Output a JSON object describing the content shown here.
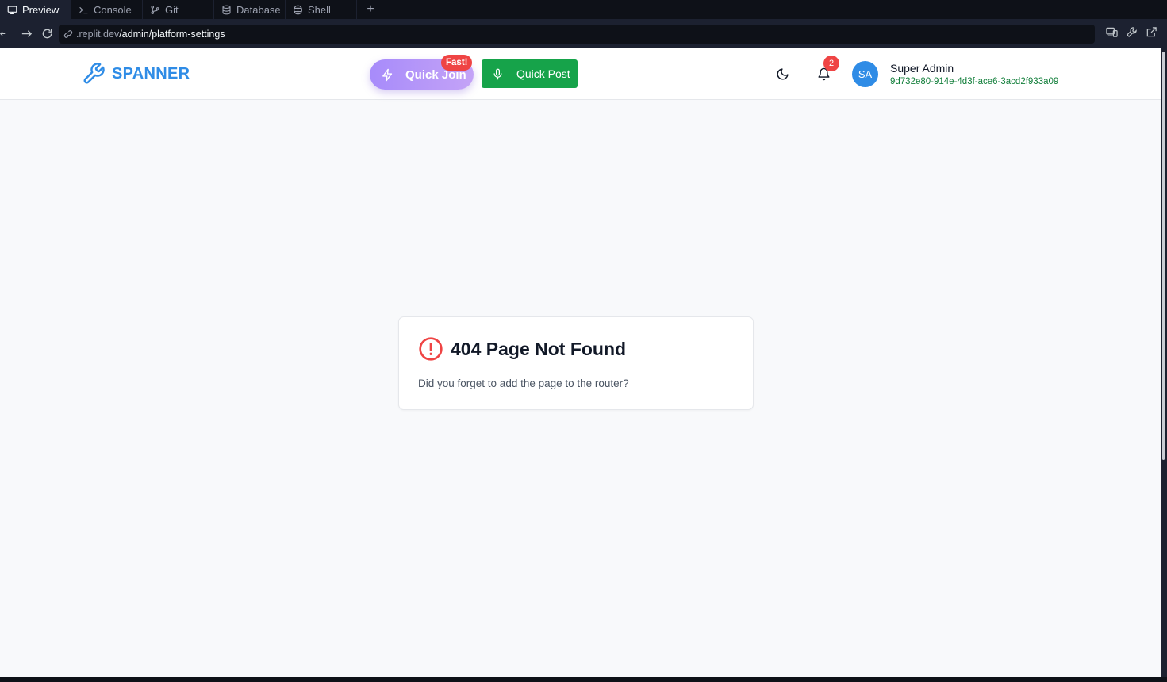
{
  "ide": {
    "tabs": [
      {
        "label": "Preview",
        "icon": "monitor-icon",
        "active": true
      },
      {
        "label": "Console",
        "icon": "terminal-icon",
        "active": false
      },
      {
        "label": "Git",
        "icon": "git-branch-icon",
        "active": false
      },
      {
        "label": "Database",
        "icon": "database-icon",
        "active": false
      },
      {
        "label": "Shell",
        "icon": "shell-icon",
        "active": false
      }
    ],
    "add_tab_label": "+",
    "url": {
      "host": ".replit.dev",
      "path": "/admin/platform-settings"
    }
  },
  "header": {
    "brand": "SPANNER",
    "quick_join": {
      "label": "Quick Join",
      "badge": "Fast!"
    },
    "quick_post": {
      "label": "Quick Post"
    },
    "notifications_count": "2",
    "user": {
      "initials": "SA",
      "name": "Super Admin",
      "id": "9d732e80-914e-4d3f-ace6-3acd2f933a09"
    }
  },
  "not_found": {
    "title": "404 Page Not Found",
    "message": "Did you forget to add the page to the router?"
  },
  "colors": {
    "brand": "#2f8ce6",
    "quick_post_bg": "#16a34a",
    "error": "#ef4444",
    "user_id": "#15803d"
  }
}
